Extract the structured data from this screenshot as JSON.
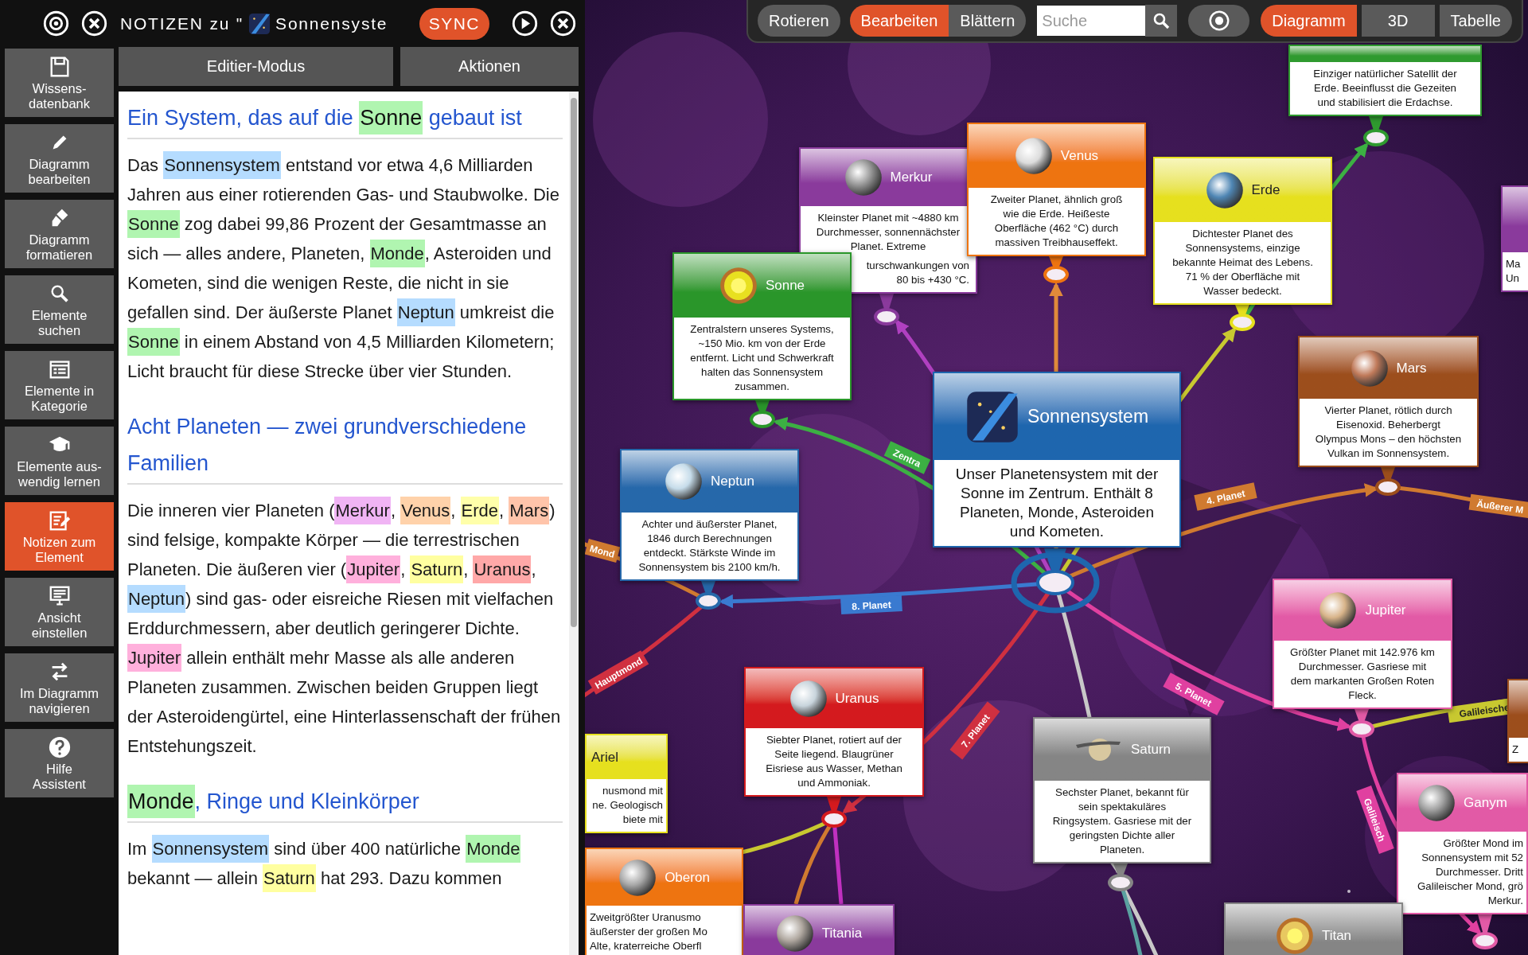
{
  "top_bar": {
    "title_prefix": "NOTIZEN zu \"",
    "title": "Sonnensyste",
    "sync": "SYNC"
  },
  "sidebar": {
    "items": [
      {
        "label": "Wissens-\ndatenbank",
        "selected": false
      },
      {
        "label": "Diagramm\nbearbeiten",
        "selected": false
      },
      {
        "label": "Diagramm\nformatieren",
        "selected": false
      },
      {
        "label": "Elemente\nsuchen",
        "selected": false
      },
      {
        "label": "Elemente in\nKategorie",
        "selected": false
      },
      {
        "label": "Elemente aus-\nwendig lernen",
        "selected": false
      },
      {
        "label": "Notizen zum\nElement",
        "selected": true
      },
      {
        "label": "Ansicht\neinstellen",
        "selected": false
      },
      {
        "label": "Im Diagramm\nnavigieren",
        "selected": false
      },
      {
        "label": "Hilfe\nAssistent",
        "selected": false
      }
    ]
  },
  "panel_tabs": [
    {
      "label": "Editier-Modus"
    },
    {
      "label": "Aktionen"
    }
  ],
  "notes": [
    {
      "kind": "heading",
      "segments": [
        {
          "text": "Ein System, das auf die "
        },
        {
          "text": "Sonne",
          "color": "#b0f5b0"
        },
        {
          "text": " gebaut ist"
        }
      ]
    },
    {
      "kind": "paragraph",
      "segments": [
        {
          "text": "Das "
        },
        {
          "text": "Sonnensystem",
          "color": "#b5dcff"
        },
        {
          "text": " entstand vor etwa 4,6 Milliarden Jahren aus einer rotierenden Gas- und Staubwolke. Die "
        },
        {
          "text": "Sonne",
          "color": "#b0f5b0"
        },
        {
          "text": " zog dabei 99,86 Prozent der Gesamtmasse an sich — alles andere, Planeten, "
        },
        {
          "text": "Monde",
          "color": "#b0f5b0"
        },
        {
          "text": ", Asteroiden und Kometen, sind die wenigen Reste, die nicht in sie gefallen sind. Der äußerste Planet "
        },
        {
          "text": "Neptun",
          "color": "#b5dcff"
        },
        {
          "text": " umkreist die "
        },
        {
          "text": "Sonne",
          "color": "#b0f5b0"
        },
        {
          "text": " in einem Abstand von 4,5 Milliarden Kilometern; Licht braucht für diese Strecke über vier Stunden."
        }
      ]
    },
    {
      "kind": "heading",
      "segments": [
        {
          "text": "Acht Planeten — zwei grundverschiedene Familien"
        }
      ]
    },
    {
      "kind": "paragraph",
      "segments": [
        {
          "text": "Die inneren vier Planeten ("
        },
        {
          "text": "Merkur",
          "color": "#f0b4f4"
        },
        {
          "text": ", "
        },
        {
          "text": "Venus",
          "color": "#ffd2aa"
        },
        {
          "text": ", "
        },
        {
          "text": "Erde",
          "color": "#ffffaa"
        },
        {
          "text": ", "
        },
        {
          "text": "Mars",
          "color": "#ffc4aa"
        },
        {
          "text": ") sind felsige, kompakte Körper — die terrestrischen Planeten. Die äußeren vier ("
        },
        {
          "text": "Jupiter",
          "color": "#ffb0dc"
        },
        {
          "text": ", "
        },
        {
          "text": "Saturn",
          "color": "#ffffa0"
        },
        {
          "text": ", "
        },
        {
          "text": "Uranus",
          "color": "#ffa8a8"
        },
        {
          "text": ", "
        },
        {
          "text": "Neptun",
          "color": "#b5dcff"
        },
        {
          "text": ") sind gas- oder eisreiche Riesen mit vielfachen Erddurchmessern, aber deutlich geringerer Dichte. "
        },
        {
          "text": "Jupiter",
          "color": "#ffb0dc"
        },
        {
          "text": " allein enthält mehr Masse als alle anderen Planeten zusammen. Zwischen beiden Gruppen liegt der Asteroidengürtel, eine Hinterlassenschaft der frühen Entstehungszeit."
        }
      ]
    },
    {
      "kind": "heading",
      "segments": [
        {
          "text": "Monde",
          "color": "#b0f5b0"
        },
        {
          "text": ", Ringe und Kleinkörper"
        }
      ]
    },
    {
      "kind": "paragraph",
      "segments": [
        {
          "text": "Im "
        },
        {
          "text": "Sonnensystem",
          "color": "#b5dcff"
        },
        {
          "text": " sind über 400 natürliche "
        },
        {
          "text": "Monde",
          "color": "#b0f5b0"
        },
        {
          "text": " bekannt — allein "
        },
        {
          "text": "Saturn",
          "color": "#ffffa0"
        },
        {
          "text": " hat 293. Dazu kommen"
        }
      ]
    }
  ],
  "toolbar": {
    "modes": [
      {
        "label": "Rotieren",
        "selected": false
      },
      {
        "label": "Bearbeiten",
        "selected": true
      },
      {
        "label": "Blättern",
        "selected": false
      }
    ],
    "search": {
      "placeholder": "Suche"
    },
    "views": [
      {
        "label": "Diagramm",
        "selected": true
      },
      {
        "label": "3D",
        "selected": false
      },
      {
        "label": "Tabelle",
        "selected": false
      }
    ]
  },
  "diagram": {
    "nodes": [
      {
        "color": "#2f9a2f",
        "lines": [
          "Einziger natürlicher Satellit der",
          "Erde. Beeinflusst die Gezeiten",
          "und stabilisiert die Erdachse."
        ]
      },
      {
        "title": "Merkur",
        "color": "#8a3a9c",
        "lines": [
          "Kleinster Planet mit ~4880 km",
          "Durchmesser, sonnennächster",
          "Planet. Extreme"
        ],
        "clipped_lines": [
          "turschwankungen von",
          "80 bis +430 °C."
        ]
      },
      {
        "title": "Venus",
        "color": "#ee7410",
        "lines": [
          "Zweiter Planet, ähnlich groß",
          "wie die Erde. Heißeste",
          "Oberfläche (462 °C) durch",
          "massiven Treibhauseffekt."
        ]
      },
      {
        "title": "Erde",
        "color": "#e6e01e",
        "lines": [
          "Dichtester Planet des",
          "Sonnensystems, einzige",
          "bekannte Heimat des Lebens.",
          "71 % der Oberfläche mit",
          "Wasser bedeckt."
        ]
      },
      {
        "title": "Sonne",
        "color": "#2a962a",
        "lines": [
          "Zentralstern unseres Systems,",
          "~150 Mio. km von der Erde",
          "entfernt. Licht und Schwerkraft",
          "halten das Sonnensystem",
          "zusammen."
        ]
      },
      {
        "title": "Neptun",
        "color": "#2668aa",
        "lines": [
          "Achter und äußerster Planet,",
          "1846 durch Berechnungen",
          "entdeckt. Stärkste Winde im",
          "Sonnensystem bis 2100 km/h."
        ]
      },
      {
        "title": "Sonnensystem",
        "color": "#1e66ae",
        "lines": [
          "Unser Planetensystem mit der",
          "Sonne im Zentrum. Enthält 8",
          "Planeten, Monde, Asteroiden",
          "und Kometen."
        ]
      },
      {
        "title": "Mars",
        "color": "#9c4e1c",
        "lines": [
          "Vierter Planet, rötlich durch",
          "Eisenoxid. Beherbergt",
          "Olympus Mons – den höchsten",
          "Vulkan im Sonnensystem."
        ]
      },
      {
        "title": "Jupiter",
        "color": "#e25aa6",
        "lines": [
          "Größter Planet mit 142.976 km",
          "Durchmesser. Gasriese mit",
          "dem markanten Großen Roten",
          "Fleck."
        ]
      },
      {
        "color": "#8a3a9c",
        "lines": [
          "Ma",
          "Un"
        ]
      },
      {
        "title": "Uranus",
        "color": "#d41a1e",
        "lines": [
          "Siebter Planet, rotiert auf der",
          "Seite liegend. Blaugrüner",
          "Eisriese aus Wasser, Methan",
          "und Ammoniak."
        ]
      },
      {
        "title": "Saturn",
        "color": "#858585",
        "lines": [
          "Sechster Planet, bekannt für",
          "sein spektakuläres",
          "Ringsystem. Gasriese mit der",
          "geringsten Dichte aller",
          "Planeten."
        ]
      },
      {
        "title": "Ariel",
        "color": "#e6e01e",
        "lines": [
          "nusmond mit",
          "ne. Geologisch",
          "biete mit"
        ]
      },
      {
        "title": "Oberon",
        "color": "#ee7410",
        "lines": [
          "Zweitgrößter Uranusmo",
          "äußerster der großen Mo",
          "Alte, kraterreiche Oberfl"
        ]
      },
      {
        "title": "Titania",
        "color": "#8a3a9c"
      },
      {
        "title": "Ganym",
        "color": "#e25aa6",
        "lines": [
          "Größter Mond im",
          "Sonnensystem mit 52",
          "Durchmesser. Dritt",
          "Galileischer Mond, grö",
          "Merkur."
        ]
      },
      {
        "title": "Titan",
        "color": "#858585"
      },
      {
        "color": "#9c4e1c",
        "lines": [
          "Z"
        ]
      }
    ],
    "edge_labels": [
      {
        "label": "Zentra",
        "color": "#3cb043"
      },
      {
        "label": "4. Planet",
        "color": "#d07a30"
      },
      {
        "label": "Äußerer M",
        "color": "#d07a30"
      },
      {
        "label": "8. Planet",
        "color": "#3a7ad0"
      },
      {
        "label": "Mond",
        "color": "#d07a30"
      },
      {
        "label": "Hauptmond",
        "color": "#d03040"
      },
      {
        "label": "7. Planet",
        "color": "#d03040"
      },
      {
        "label": "5. Planet",
        "color": "#e040a0"
      },
      {
        "label": "Galileische",
        "color": "#c8c830"
      },
      {
        "label": "Galileisch",
        "color": "#e040a0"
      }
    ]
  }
}
